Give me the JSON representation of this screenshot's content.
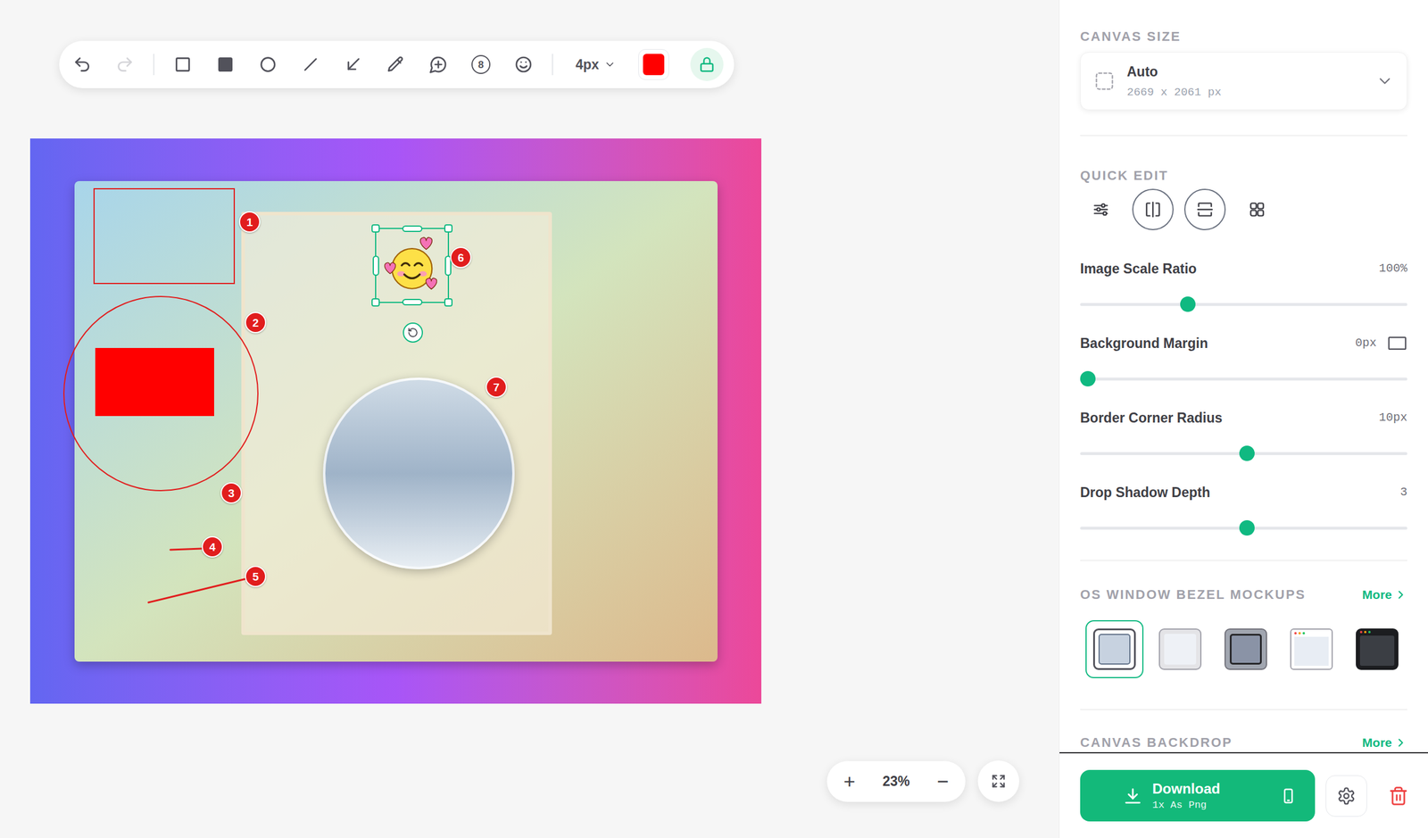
{
  "toolbar": {
    "history": [
      {
        "kind": "undo",
        "disabled": false
      },
      {
        "kind": "redo",
        "disabled": true
      }
    ],
    "tools": [
      {
        "kind": "rectangle",
        "selected": false
      },
      {
        "kind": "filled-rectangle",
        "selected": false
      },
      {
        "kind": "ellipse",
        "selected": false
      },
      {
        "kind": "line",
        "selected": false
      },
      {
        "kind": "arrow",
        "selected": false
      },
      {
        "kind": "pen",
        "selected": false
      },
      {
        "kind": "callout",
        "selected": false
      },
      {
        "kind": "counter",
        "label": "8",
        "selected": false
      },
      {
        "kind": "emoji",
        "selected": false
      }
    ],
    "stroke_width": "4px",
    "stroke_color": "#ff0000",
    "locked": true
  },
  "canvas": {
    "annotations": [
      {
        "kind": "rect"
      },
      {
        "kind": "ellipse"
      },
      {
        "kind": "filled-rect"
      },
      {
        "kind": "line"
      },
      {
        "kind": "line"
      },
      {
        "kind": "magnifier"
      },
      {
        "kind": "emoji",
        "selected": true
      },
      {
        "kind": "badge",
        "label": "1"
      },
      {
        "kind": "badge",
        "label": "2"
      },
      {
        "kind": "badge",
        "label": "3"
      },
      {
        "kind": "badge",
        "label": "4"
      },
      {
        "kind": "badge",
        "label": "5"
      },
      {
        "kind": "badge",
        "label": "6"
      },
      {
        "kind": "badge",
        "label": "7"
      }
    ]
  },
  "zoom": {
    "zoom_in": "+",
    "level": "23%",
    "zoom_out": "−"
  },
  "sidebar": {
    "canvas_size": {
      "title": "CANVAS SIZE",
      "value": "Auto",
      "dimensions": "2669 x 2061 px"
    },
    "quick_edit": {
      "title": "QUICK EDIT",
      "buttons": [
        {
          "kind": "adjust",
          "selected": false
        },
        {
          "kind": "split-vertical",
          "selected": true
        },
        {
          "kind": "split-horizontal",
          "selected": true
        },
        {
          "kind": "grid",
          "selected": false
        }
      ]
    },
    "sliders": [
      {
        "label": "Image Scale Ratio",
        "reading": "100%",
        "level": 0.32,
        "kind": "plain"
      },
      {
        "label": "Background Margin",
        "reading": "0px",
        "level": 0.0,
        "kind": "toggle"
      },
      {
        "label": "Border Corner Radius",
        "reading": "10px",
        "level": 0.51,
        "kind": "plain"
      },
      {
        "label": "Drop Shadow Depth",
        "reading": "3",
        "level": 0.51,
        "kind": "plain"
      }
    ],
    "bezels": {
      "title": "OS WINDOW BEZEL MOCKUPS",
      "more": "More",
      "items": [
        {
          "kind": "plain",
          "selected": true
        },
        {
          "kind": "soft",
          "selected": false
        },
        {
          "kind": "shaded",
          "selected": false
        },
        {
          "kind": "browser",
          "selected": false
        },
        {
          "kind": "dark",
          "selected": false
        }
      ]
    },
    "backdrop": {
      "title": "CANVAS BACKDROP",
      "more": "More"
    },
    "download": {
      "label": "Download",
      "sub": "1x As Png"
    }
  }
}
